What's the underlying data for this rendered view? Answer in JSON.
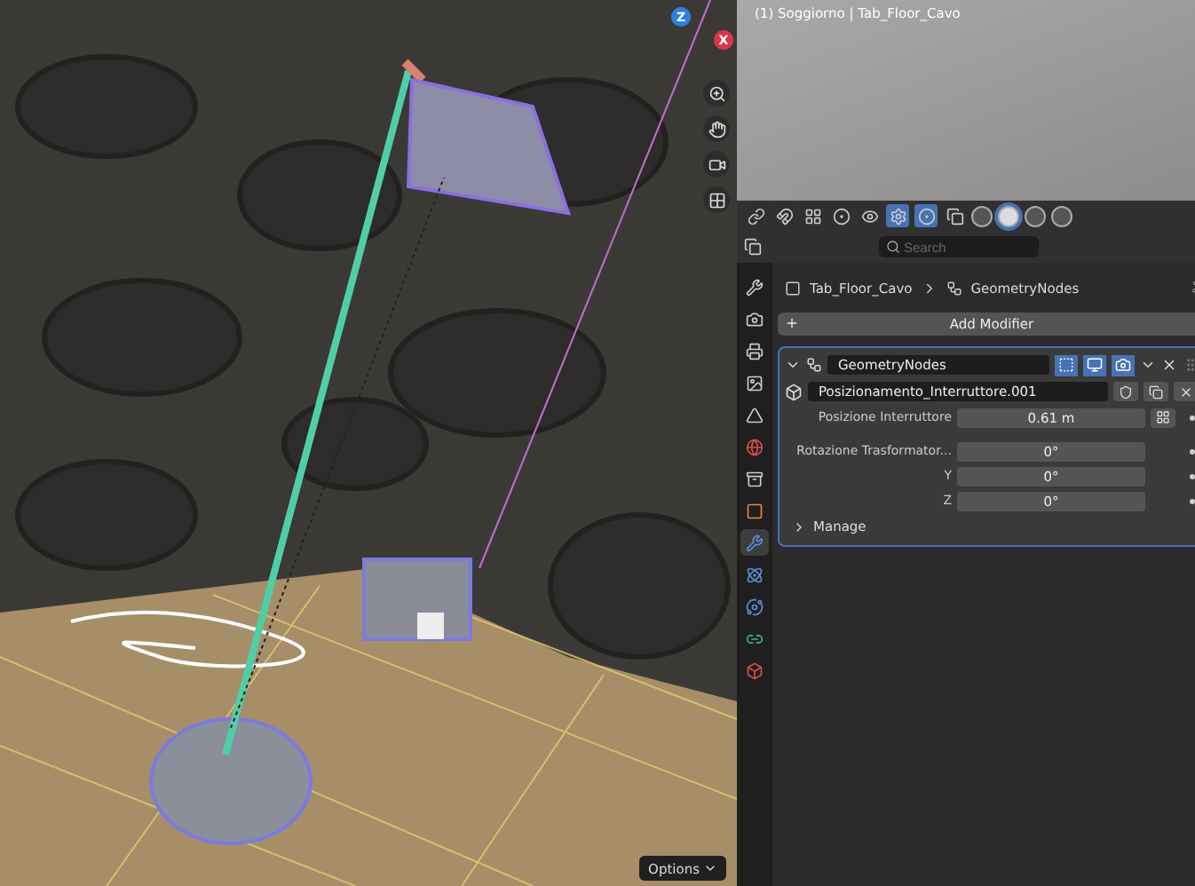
{
  "viewport": {
    "options_label": "Options",
    "axes": [
      {
        "label": "Z",
        "color": "#2f7fe0"
      },
      {
        "label": "X",
        "color": "#d8374a"
      }
    ]
  },
  "preview": {
    "caption": "(1) Soggiorno | Tab_Floor_Cavo"
  },
  "shading_modes": [
    {
      "selected": false
    },
    {
      "selected": true
    },
    {
      "selected": false
    },
    {
      "selected": false
    }
  ],
  "properties": {
    "search": {
      "placeholder": "Search"
    },
    "tabs": [
      {
        "kind": "tool",
        "selected": false
      },
      {
        "kind": "render",
        "selected": false
      },
      {
        "kind": "output",
        "selected": false
      },
      {
        "kind": "view_layer",
        "selected": false
      },
      {
        "kind": "scene",
        "selected": false
      },
      {
        "kind": "world",
        "selected": false
      },
      {
        "kind": "collection",
        "selected": false
      },
      {
        "kind": "object",
        "selected": false
      },
      {
        "kind": "modifier",
        "selected": true
      },
      {
        "kind": "particles",
        "selected": false
      },
      {
        "kind": "physics",
        "selected": false
      },
      {
        "kind": "constraints",
        "selected": false
      },
      {
        "kind": "data",
        "selected": false
      }
    ],
    "breadcrumb": {
      "object": "Tab_Floor_Cavo",
      "modifier": "GeometryNodes"
    },
    "add_modifier": "Add Modifier",
    "modifier": {
      "name": "GeometryNodes",
      "expanded": true,
      "toggles": [
        {
          "kind": "edit",
          "on": true
        },
        {
          "kind": "viewport",
          "on": true
        },
        {
          "kind": "render",
          "on": true
        }
      ],
      "node_group": "Posizionamento_Interruttore.001",
      "inputs": [
        {
          "kind": "attribute",
          "label": "Posizione Interruttore",
          "value": "0.61 m"
        },
        {
          "kind": "value",
          "label": "Rotazione Trasformator...",
          "value": "0°"
        },
        {
          "kind": "value",
          "label": "Y",
          "value": "0°"
        },
        {
          "kind": "value",
          "label": "Z",
          "value": "0°"
        }
      ],
      "manage": {
        "label": "Manage",
        "expanded": false
      }
    }
  }
}
